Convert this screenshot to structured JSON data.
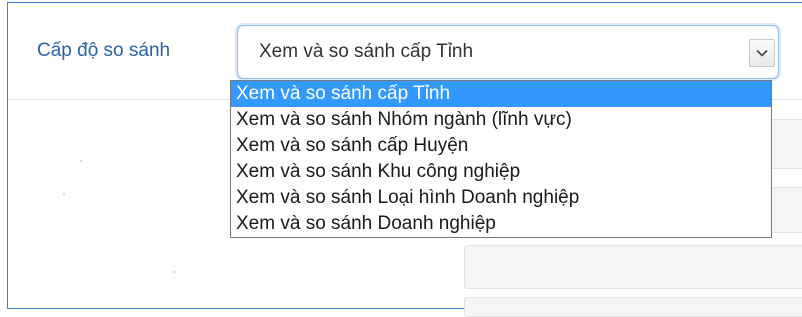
{
  "form": {
    "field_label": "Cấp độ so sánh",
    "selected_value": "Xem và so sánh cấp Tỉnh"
  },
  "dropdown": {
    "options": [
      {
        "label": "Xem và so sánh cấp Tỉnh",
        "selected": true
      },
      {
        "label": "Xem và so sánh Nhóm ngành (lĩnh vực)",
        "selected": false
      },
      {
        "label": "Xem và so sánh cấp Huyện",
        "selected": false
      },
      {
        "label": "Xem và so sánh Khu công nghiệp",
        "selected": false
      },
      {
        "label": "Xem và so sánh Loại hình Doanh nghiệp",
        "selected": false
      },
      {
        "label": "Xem và so sánh Doanh nghiệp",
        "selected": false
      }
    ]
  },
  "colors": {
    "frame_border": "#3b7fd0",
    "label_text": "#2b63a8",
    "highlight": "#3399ff"
  },
  "icons": {
    "select_arrow": "chevron-down-icon"
  }
}
